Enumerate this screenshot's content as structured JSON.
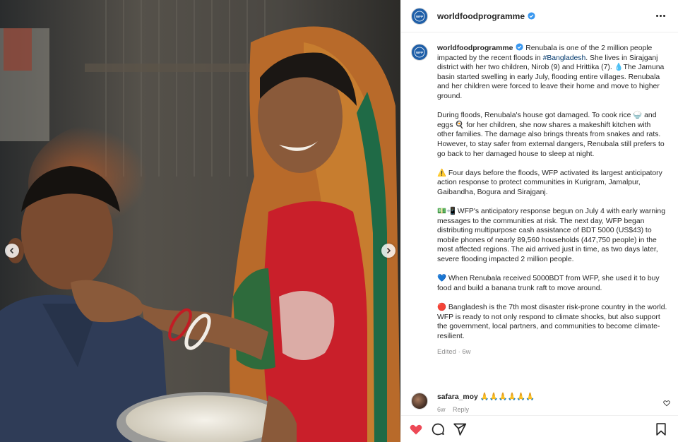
{
  "post": {
    "username": "worldfoodprogramme",
    "avatar_text": "WFP",
    "caption_intro": " Renubala is one of the 2 million people impacted by the recent floods in ",
    "hashtag": "#Bangladesh",
    "caption_intro_end": ". She lives in Sirajganj district with her two children, Nirob (9) and Hrittika (7). 💧The Jamuna basin started swelling in early July, flooding entire villages. Renubala and her children were forced to leave their home and move to higher ground.",
    "paragraphs": [
      "During floods, Renubala's house got damaged. To cook rice 🍚 and eggs 🍳 for her children, she now shares a makeshift kitchen with other families. The damage also brings threats from snakes and rats. However, to stay safer from external dangers, Renubala still prefers to go back to her damaged house to sleep at night.",
      "⚠️ Four days before the floods, WFP activated its largest anticipatory action response to protect communities in Kurigram, Jamalpur, Gaibandha, Bogura and Sirajganj.",
      "💵📲 WFP's anticipatory response begun on July 4 with early warning messages to the communities at risk. The next day, WFP began distributing multipurpose cash assistance of BDT 5000 (US$43) to mobile phones of nearly 89,560 households (447,750 people) in the most affected regions. The aid arrived just in time, as two days later, severe flooding impacted 2 million people.",
      "💙 When Renubala received 5000BDT from WFP, she used it to buy food and build a banana trunk raft to move around.",
      "🔴 Bangladesh is the 7th most disaster risk-prone country in the world. WFP is ready to not only respond to climate shocks, but also support the government, local partners, and communities to become climate-resilient."
    ],
    "edited_label": "Edited · 6w"
  },
  "comment": {
    "username": "safara_moy",
    "text": "🙏🙏🙏🙏🙏🙏",
    "time": "6w",
    "reply": "Reply"
  },
  "icons": {
    "like": "heart-icon",
    "comment": "comment-icon",
    "share": "paper-plane-icon",
    "save": "bookmark-icon"
  },
  "colors": {
    "like_red": "#ed4956",
    "verified_blue": "#3897f0",
    "hashtag_blue": "#00376b",
    "wfp_blue": "#1f5fa8"
  }
}
